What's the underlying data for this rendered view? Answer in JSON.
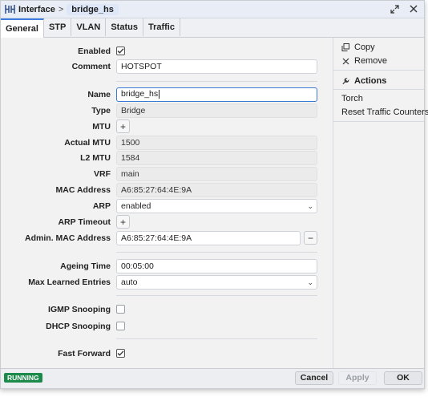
{
  "titlebar": {
    "section": "Interface",
    "separator": ">",
    "name": "bridge_hs"
  },
  "tabs": [
    "General",
    "STP",
    "VLAN",
    "Status",
    "Traffic"
  ],
  "form": {
    "enabled_label": "Enabled",
    "enabled": true,
    "comment_label": "Comment",
    "comment": "HOTSPOT",
    "name_label": "Name",
    "name": "bridge_hs",
    "type_label": "Type",
    "type": "Bridge",
    "mtu_label": "MTU",
    "actual_mtu_label": "Actual MTU",
    "actual_mtu": "1500",
    "l2_mtu_label": "L2 MTU",
    "l2_mtu": "1584",
    "vrf_label": "VRF",
    "vrf": "main",
    "mac_label": "MAC Address",
    "mac": "A6:85:27:64:4E:9A",
    "arp_label": "ARP",
    "arp": "enabled",
    "arp_timeout_label": "ARP Timeout",
    "admin_mac_label": "Admin. MAC Address",
    "admin_mac": "A6:85:27:64:4E:9A",
    "ageing_label": "Ageing Time",
    "ageing": "00:05:00",
    "max_learned_label": "Max Learned Entries",
    "max_learned": "auto",
    "igmp_label": "IGMP Snooping",
    "igmp": false,
    "dhcp_label": "DHCP Snooping",
    "dhcp": false,
    "fast_forward_label": "Fast Forward",
    "fast_forward": true
  },
  "side": {
    "copy": "Copy",
    "remove": "Remove",
    "actions": "Actions",
    "torch": "Torch",
    "reset": "Reset Traffic Counters"
  },
  "statusbar": {
    "status": "RUNNING",
    "status_color": "#1b8a4a",
    "cancel": "Cancel",
    "apply": "Apply",
    "ok": "OK"
  },
  "colors": {
    "accent": "#3a7bd5",
    "running": "#1b8a4a"
  }
}
